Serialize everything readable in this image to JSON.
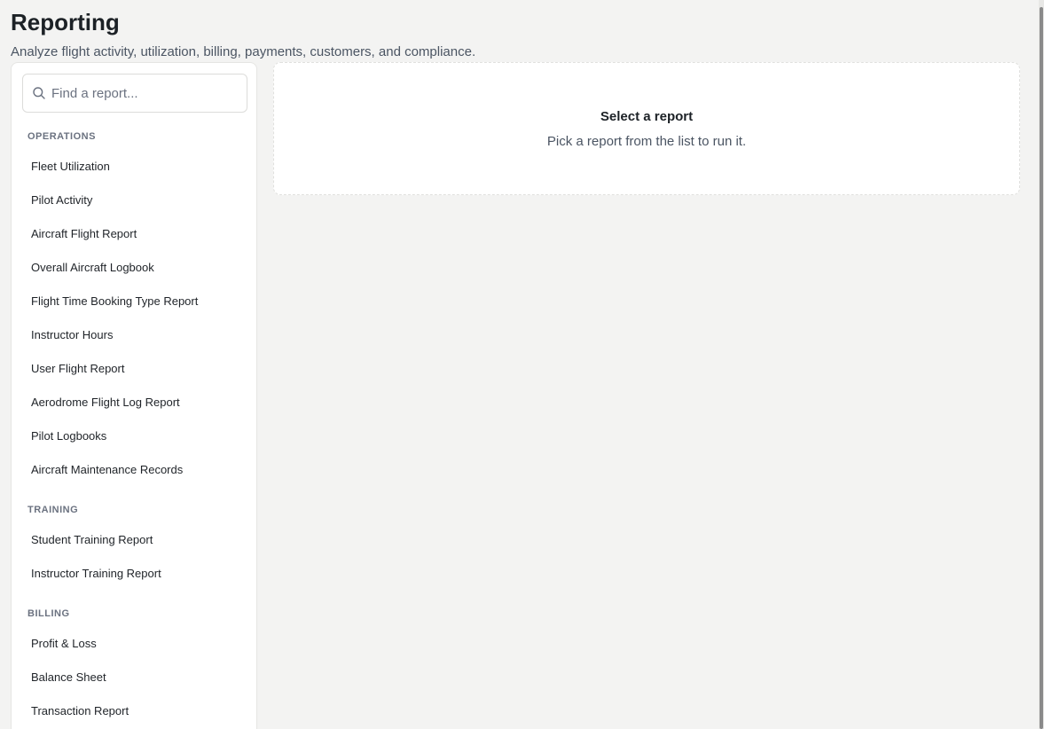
{
  "header": {
    "title": "Reporting",
    "subtitle": "Analyze flight activity, utilization, billing, payments, customers, and compliance."
  },
  "search": {
    "placeholder": "Find a report...",
    "value": ""
  },
  "sections": [
    {
      "label": "OPERATIONS",
      "items": [
        "Fleet Utilization",
        "Pilot Activity",
        "Aircraft Flight Report",
        "Overall Aircraft Logbook",
        "Flight Time Booking Type Report",
        "Instructor Hours",
        "User Flight Report",
        "Aerodrome Flight Log Report",
        "Pilot Logbooks",
        "Aircraft Maintenance Records"
      ]
    },
    {
      "label": "TRAINING",
      "items": [
        "Student Training Report",
        "Instructor Training Report"
      ]
    },
    {
      "label": "BILLING",
      "items": [
        "Profit & Loss",
        "Balance Sheet",
        "Transaction Report"
      ]
    }
  ],
  "empty_state": {
    "title": "Select a report",
    "description": "Pick a report from the list to run it."
  },
  "icons": {
    "search": "search-icon"
  }
}
